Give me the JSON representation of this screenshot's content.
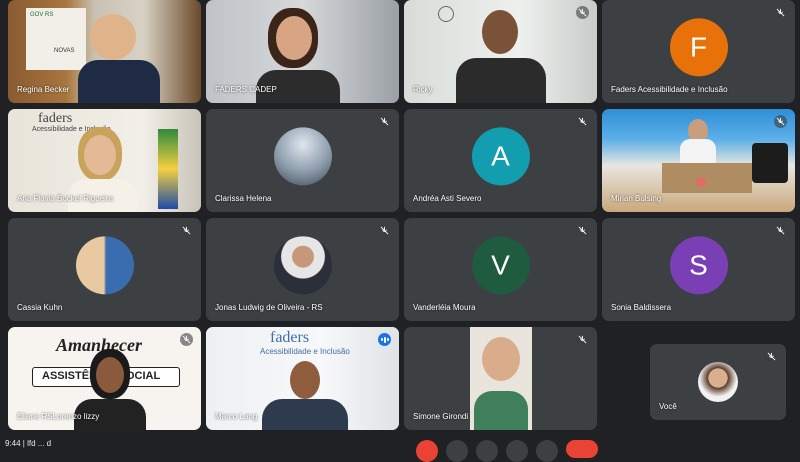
{
  "participants": [
    {
      "name": "Regina Becker"
    },
    {
      "name": "FADERS CADEP"
    },
    {
      "name": "Ricky"
    },
    {
      "name": "Faders Acessibilidade e Inclusão",
      "initial": "F"
    },
    {
      "name": "Ana Flavia Bockel Rigueira"
    },
    {
      "name": "Clarissa Helena"
    },
    {
      "name": "Andréa Asti Severo",
      "initial": "A"
    },
    {
      "name": "Mirian Bulsing"
    },
    {
      "name": "Cassia Kuhn"
    },
    {
      "name": "Jonas Ludwig de Oliveira - RS"
    },
    {
      "name": "Vanderléia Moura",
      "initial": "V"
    },
    {
      "name": "Sonia Baldissera",
      "initial": "S"
    },
    {
      "name": "Eliane RSLorenzo lizzy"
    },
    {
      "name": "Marco Lang"
    },
    {
      "name": "Simone Girondi"
    },
    {
      "name": "Você"
    }
  ],
  "background_text": {
    "gov_rs": "GOV RS",
    "novas": "NOVAS",
    "faders_sign": "faders",
    "acess_sign": "Acessibilidade e Inclusão",
    "amanhecer": "Amanhecer",
    "assist": "ASSISTÊNCIA SOCIAL"
  },
  "colors": {
    "tile_bg": "#3c4043",
    "page_bg": "#202124",
    "avatar_F": "#e8710a",
    "avatar_A": "#129eaf",
    "avatar_V": "#1e5b3f",
    "avatar_S": "#7b3fb5",
    "active_speaker": "#8ab4f8"
  },
  "bottom": {
    "info": "9:44 | lfd   ... d"
  }
}
